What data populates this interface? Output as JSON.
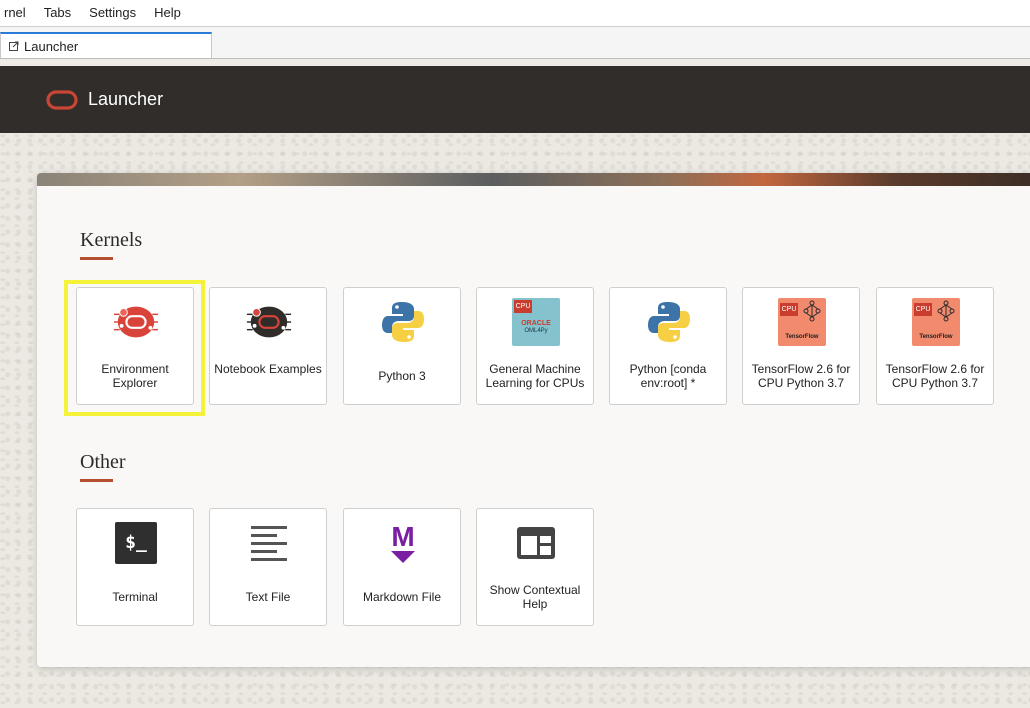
{
  "menubar": {
    "items": [
      "rnel",
      "Tabs",
      "Settings",
      "Help"
    ]
  },
  "tabbar": {
    "active_tab": "Launcher"
  },
  "header": {
    "title": "Launcher",
    "brand_color": "#c74634"
  },
  "kernels": {
    "title": "Kernels",
    "tiles": [
      {
        "label": "Environment Explorer",
        "icon": "environment-explorer-icon",
        "highlighted": true
      },
      {
        "label": "Notebook Examples",
        "icon": "notebook-examples-icon"
      },
      {
        "label": "Python 3",
        "icon": "python-icon"
      },
      {
        "label": "General Machine Learning for CPUs",
        "icon": "oml4py-icon",
        "badge": "CPU",
        "brand": "ORACLE",
        "sub": "OML4Py"
      },
      {
        "label": "Python [conda env:root] *",
        "icon": "python-icon"
      },
      {
        "label": "TensorFlow 2.6 for CPU Python 3.7",
        "icon": "tensorflow-icon",
        "badge": "CPU",
        "brand": "TensorFlow"
      },
      {
        "label": "TensorFlow 2.6 for CPU Python 3.7",
        "icon": "tensorflow-icon",
        "badge": "CPU",
        "brand": "TensorFlow"
      }
    ]
  },
  "other": {
    "title": "Other",
    "tiles": [
      {
        "label": "Terminal",
        "icon": "terminal-icon",
        "glyph": "$_"
      },
      {
        "label": "Text File",
        "icon": "text-file-icon"
      },
      {
        "label": "Markdown File",
        "icon": "markdown-icon",
        "glyph": "M"
      },
      {
        "label": "Show Contextual Help",
        "icon": "contextual-help-icon"
      }
    ]
  },
  "colors": {
    "accent_underline": "#b3502f",
    "highlight": "#f5f23a",
    "header_bg": "#312d2a"
  }
}
